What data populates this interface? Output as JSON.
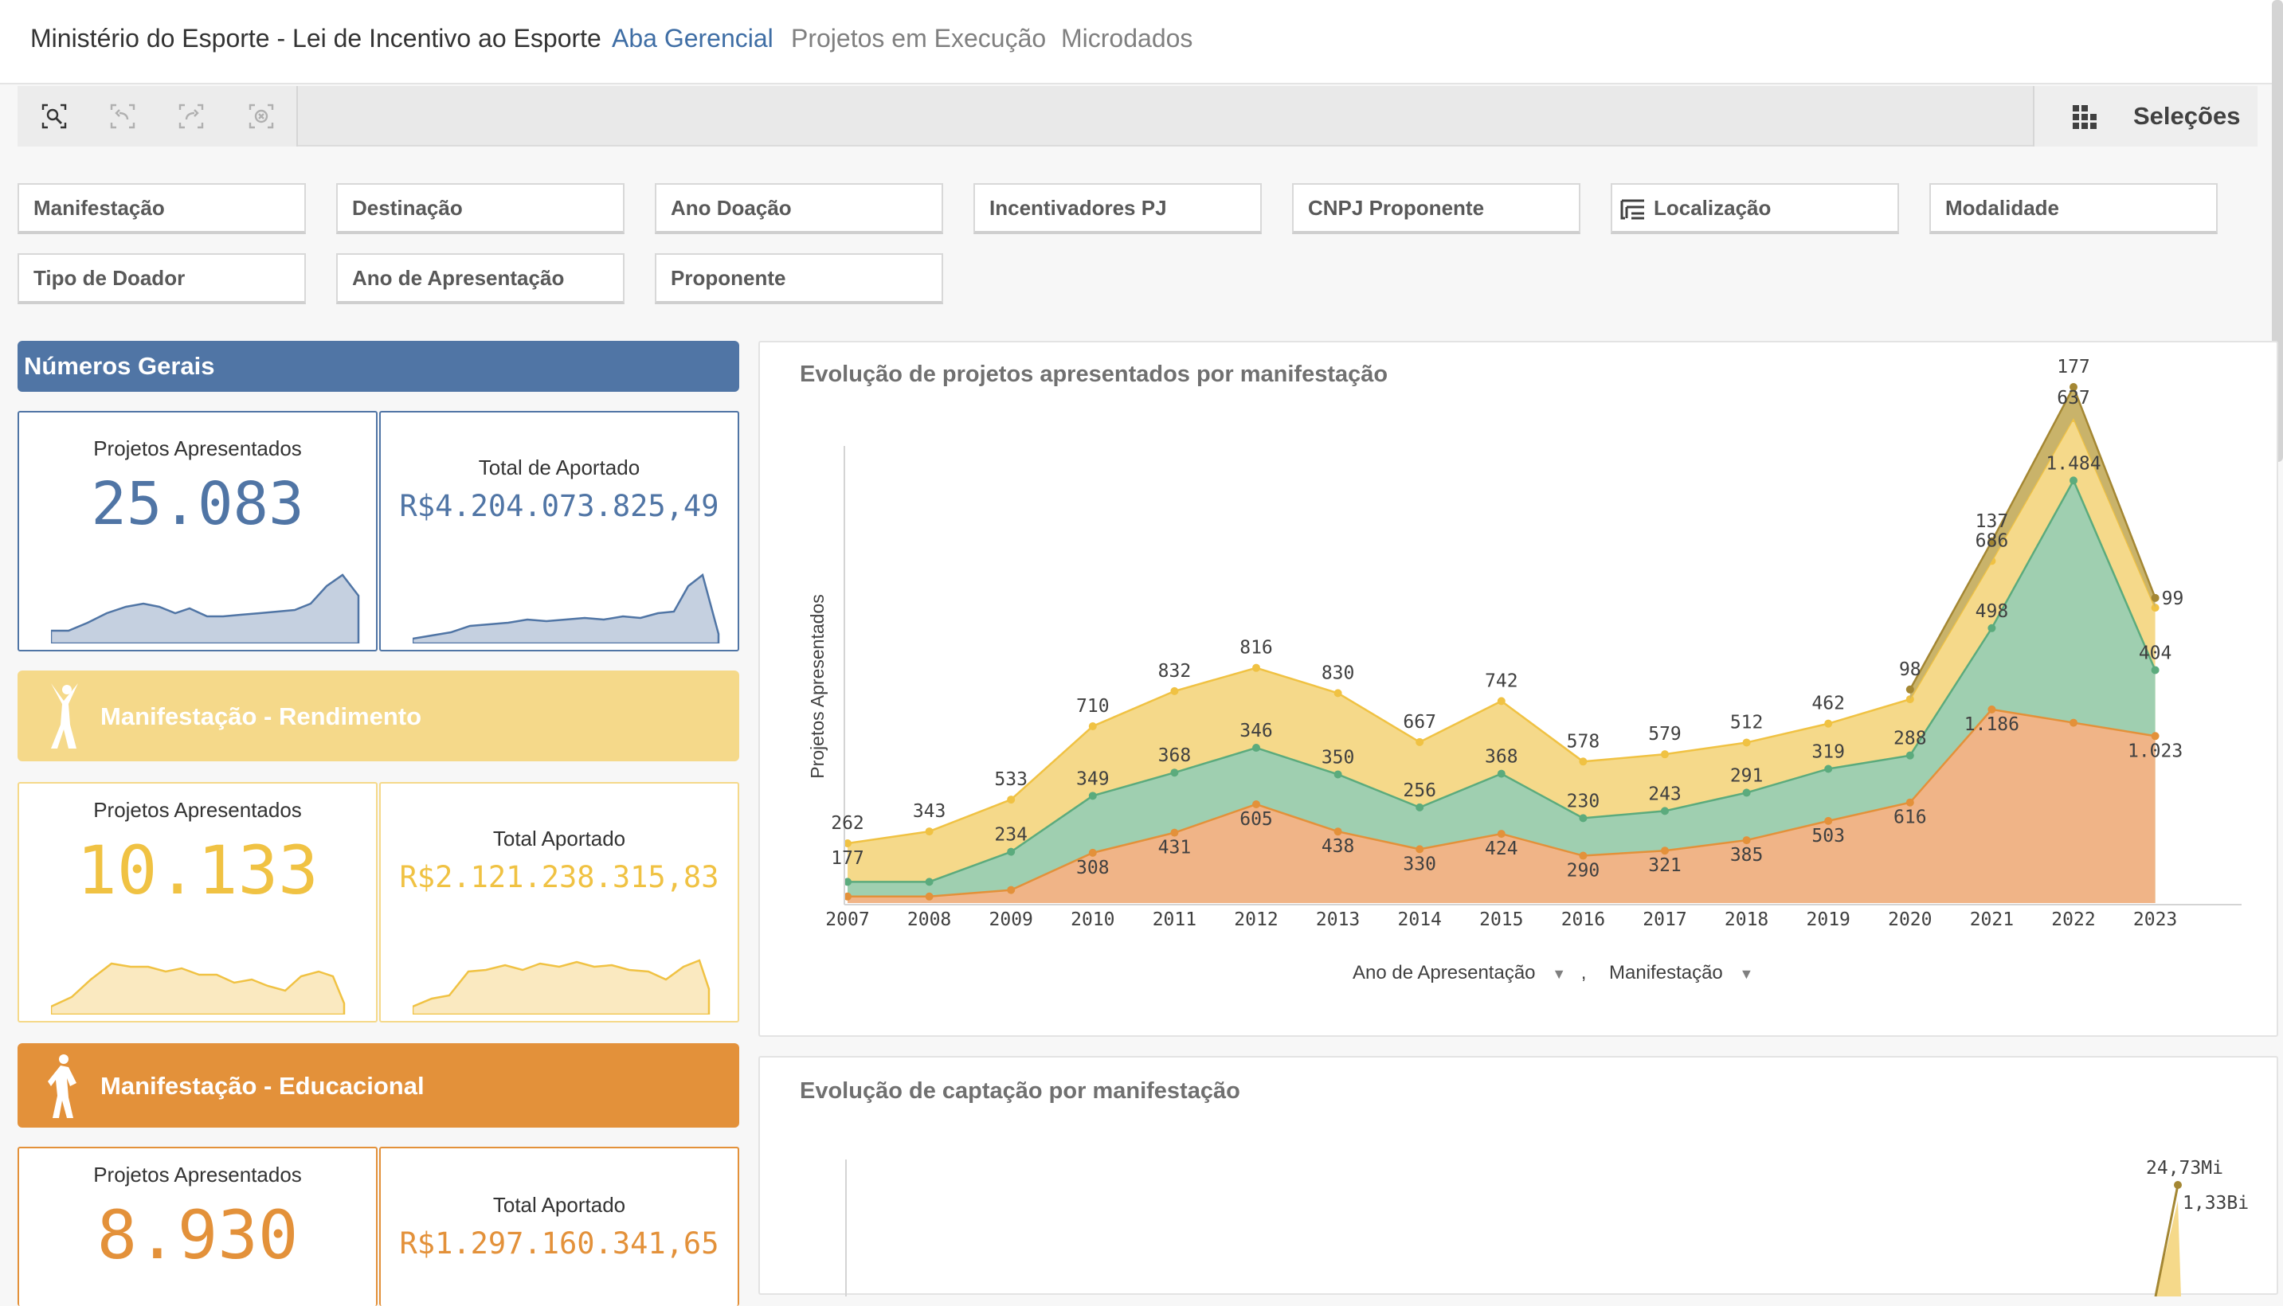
{
  "app": {
    "title": "Ministério do Esporte - Lei de Incentivo ao Esporte",
    "tabs": [
      "Aba Gerencial",
      "Projetos em Execução",
      "Microdados"
    ],
    "active_tab": "Aba Gerencial"
  },
  "toolbar": {
    "icons": [
      "smart-search-icon",
      "step-back-icon",
      "step-forward-icon",
      "clear-selections-icon",
      "selections-grid-icon"
    ],
    "selections_label": "Seleções"
  },
  "filters": [
    "Manifestação",
    "Destinação",
    "Ano Doação",
    "Incentivadores PJ",
    "CNPJ Proponente",
    "Localização",
    "Modalidade",
    "Tipo de Doador",
    "Ano de Apresentação",
    "Proponente"
  ],
  "colors": {
    "blue": "#5075a5",
    "yellow": "#f5d98a",
    "yellow_text": "#f0c243",
    "orange": "#e3913a",
    "green": "#5bab7d",
    "brown": "#a48733"
  },
  "sections": {
    "general": {
      "title": "Números Gerais",
      "kpi_projects": {
        "label": "Projetos Apresentados",
        "value": "25.083"
      },
      "kpi_total": {
        "label": "Total de Aportado",
        "value": "R$4.204.073.825,49"
      }
    },
    "rendimento": {
      "title": "Manifestação - Rendimento",
      "icon": "athlete-icon",
      "kpi_projects": {
        "label": "Projetos Apresentados",
        "value": "10.133"
      },
      "kpi_total": {
        "label": "Total Aportado",
        "value": "R$2.121.238.315,83"
      }
    },
    "educacional": {
      "title": "Manifestação - Educacional",
      "icon": "athlete-icon",
      "kpi_projects": {
        "label": "Projetos Apresentados",
        "value": "8.930"
      },
      "kpi_total": {
        "label": "Total Aportado",
        "value": "R$1.297.160.341,65"
      }
    }
  },
  "charts": {
    "projects_evolution": {
      "title": "Evolução de projetos apresentados por manifestação",
      "footer_dim1": "Ano de Apresentação",
      "footer_sep": ",",
      "footer_dim2": "Manifestação"
    },
    "captacao_evolution": {
      "title": "Evolução de captação por manifestação",
      "labels": [
        "24,73Mi",
        "1,33Bi"
      ]
    }
  },
  "chart_data": [
    {
      "type": "area",
      "stacked": true,
      "title": "Evolução de projetos apresentados por manifestação",
      "xlabel": "Ano de Apresentação",
      "ylabel": "Projetos Apresentados",
      "x": [
        "2007",
        "2008",
        "2009",
        "2010",
        "2011",
        "2012",
        "2013",
        "2014",
        "2015",
        "2016",
        "2017",
        "2018",
        "2019",
        "2020",
        "2021",
        "2022",
        "2023"
      ],
      "grid": false,
      "series": [
        {
          "values": [
            null,
            null,
            null,
            308,
            431,
            605,
            438,
            330,
            424,
            290,
            321,
            385,
            503,
            616,
            1186,
            null,
            1023
          ]
        },
        {
          "values": [
            null,
            null,
            234,
            349,
            368,
            346,
            350,
            256,
            368,
            230,
            243,
            291,
            319,
            288,
            498,
            1484,
            404
          ]
        },
        {
          "values": [
            262,
            343,
            533,
            710,
            832,
            816,
            830,
            667,
            742,
            578,
            579,
            512,
            462,
            null,
            686,
            637,
            null
          ]
        },
        {
          "values": [
            177,
            null,
            null,
            null,
            null,
            null,
            null,
            null,
            null,
            null,
            null,
            null,
            null,
            98,
            137,
            177,
            99
          ]
        }
      ]
    },
    {
      "type": "area",
      "title": "Evolução de captação por manifestação",
      "data_labels": [
        "24,73Mi",
        "1,33Bi"
      ]
    }
  ]
}
